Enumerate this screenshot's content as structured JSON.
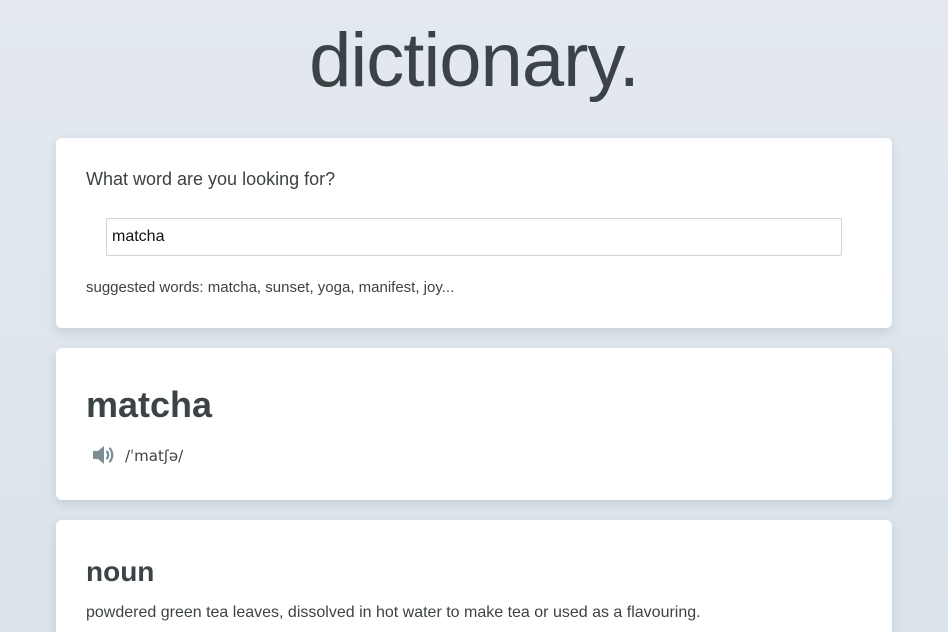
{
  "app": {
    "title": "dictionary."
  },
  "search": {
    "question": "What word are you looking for?",
    "value": "matcha",
    "suggestions": "suggested words: matcha, sunset, yoga, manifest, joy..."
  },
  "result": {
    "word": "matcha",
    "phonetic": "/ˈmatʃə/",
    "audio_icon": "speaker-icon"
  },
  "meanings": [
    {
      "part_of_speech": "noun",
      "definition": "powdered green tea leaves, dissolved in hot water to make tea or used as a flavouring."
    }
  ],
  "colors": {
    "background": "#dfe6ec",
    "card": "#ffffff",
    "text": "#3d4245",
    "icon": "#7a8e93"
  }
}
